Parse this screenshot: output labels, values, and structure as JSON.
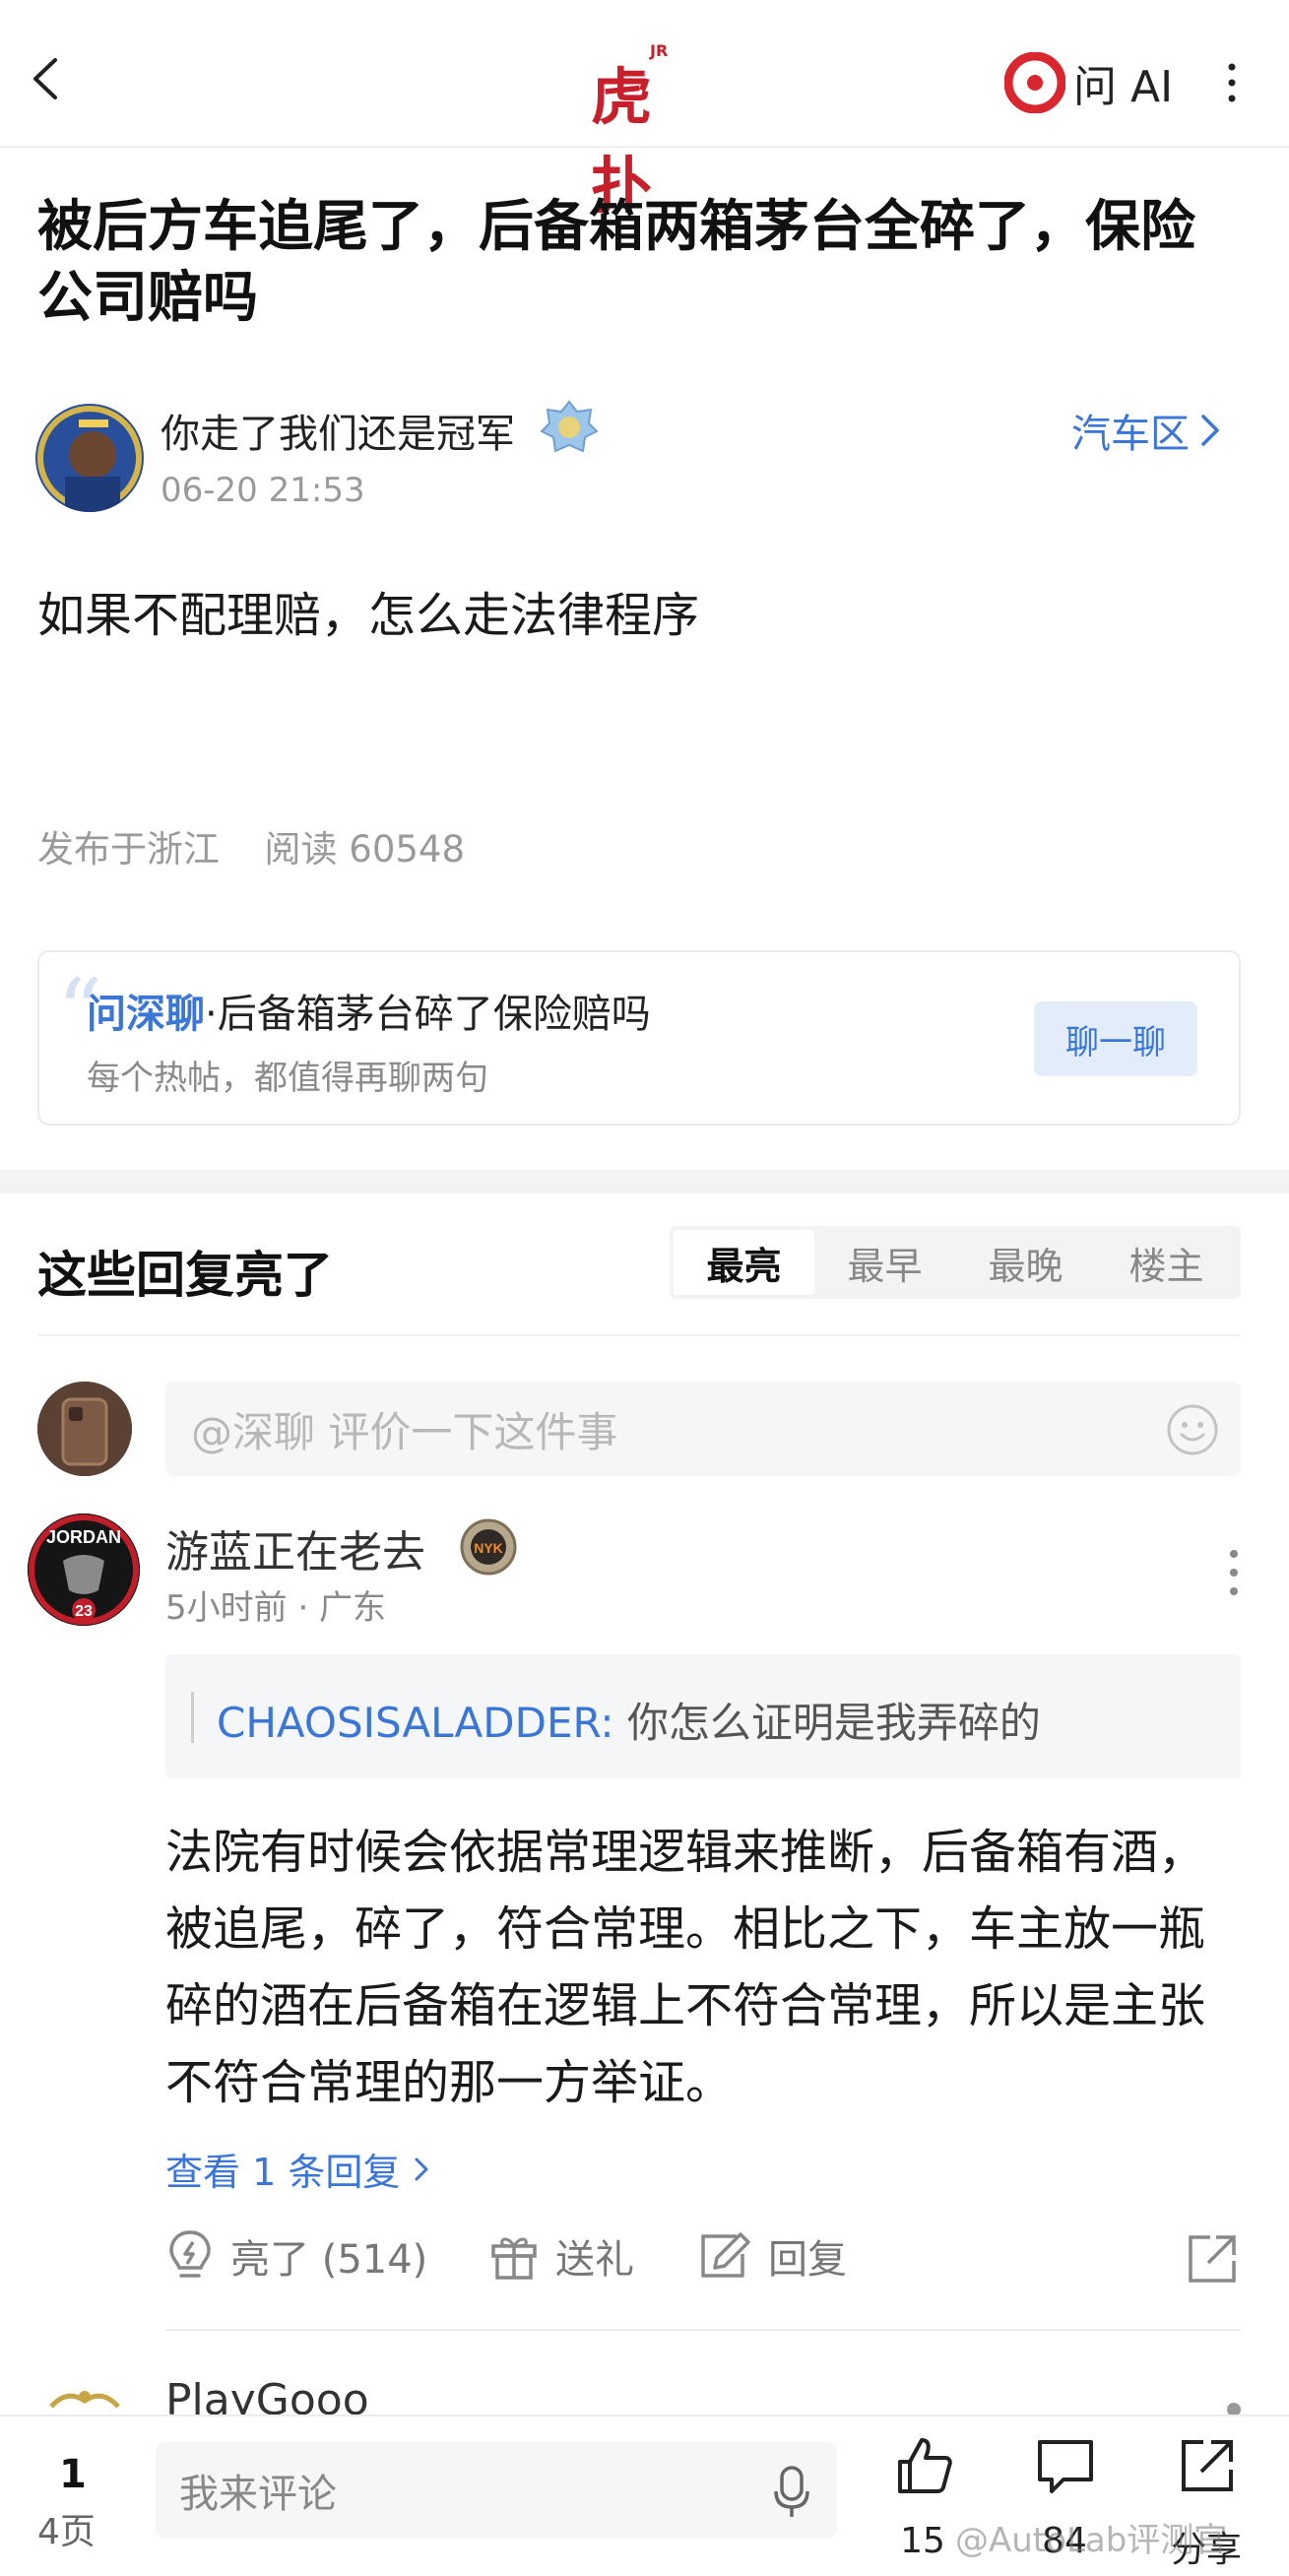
{
  "header": {
    "logo_text": "虎扑",
    "logo_superscript": "JR",
    "ask_ai_label": "问 AI"
  },
  "post": {
    "title": "被后方车追尾了，后备箱两箱茅台全碎了，保险公司赔吗",
    "author_name": "你走了我们还是冠军",
    "time": "06-20 21:53",
    "board": "汽车区",
    "body": "如果不配理赔，怎么走法律程序",
    "location": "发布于浙江",
    "read_label": "阅读",
    "read_count": "60548"
  },
  "deep_chat": {
    "quote_mark": "“",
    "brand": "问深聊",
    "topic": "·后备箱茅台碎了保险赔吗",
    "subtitle": "每个热帖，都值得再聊两句",
    "button": "聊一聊"
  },
  "replies": {
    "title": "这些回复亮了",
    "sort_tabs": [
      {
        "label": "最亮",
        "active": true
      },
      {
        "label": "最早",
        "active": false
      },
      {
        "label": "最晚",
        "active": false
      },
      {
        "label": "楼主",
        "active": false
      }
    ],
    "ai_input_placeholder": "@深聊 评价一下这件事",
    "items": [
      {
        "avatar_text": "JORDAN",
        "avatar_number": "23",
        "name": "游蓝正在老去",
        "badge_text": "NYK",
        "meta": "5小时前 · 广东",
        "quote_user": "CHAOSISALADDER:",
        "quote_text": " 你怎么证明是我弄碎的",
        "body": "法院有时候会依据常理逻辑来推断，后备箱有酒，被追尾，碎了，符合常理。相比之下，车主放一瓶碎的酒在后备箱在逻辑上不符合常理，所以是主张不符合常理的那一方举证。",
        "view_replies": "查看 1 条回复",
        "actions": {
          "light": "亮了 (514)",
          "gift": "送礼",
          "reply": "回复"
        }
      },
      {
        "name": "PlayGooo"
      }
    ]
  },
  "bottom_bar": {
    "page_current": "1",
    "page_total": "4页",
    "comment_placeholder": "我来评论",
    "like_count": "15",
    "comment_count": "84",
    "share_label": "分享"
  },
  "watermark": "@AutoLab评测官",
  "colors": {
    "brand_red": "#c8202a",
    "link_blue": "#3a76d8",
    "muted_gray": "#9a9a9a"
  }
}
